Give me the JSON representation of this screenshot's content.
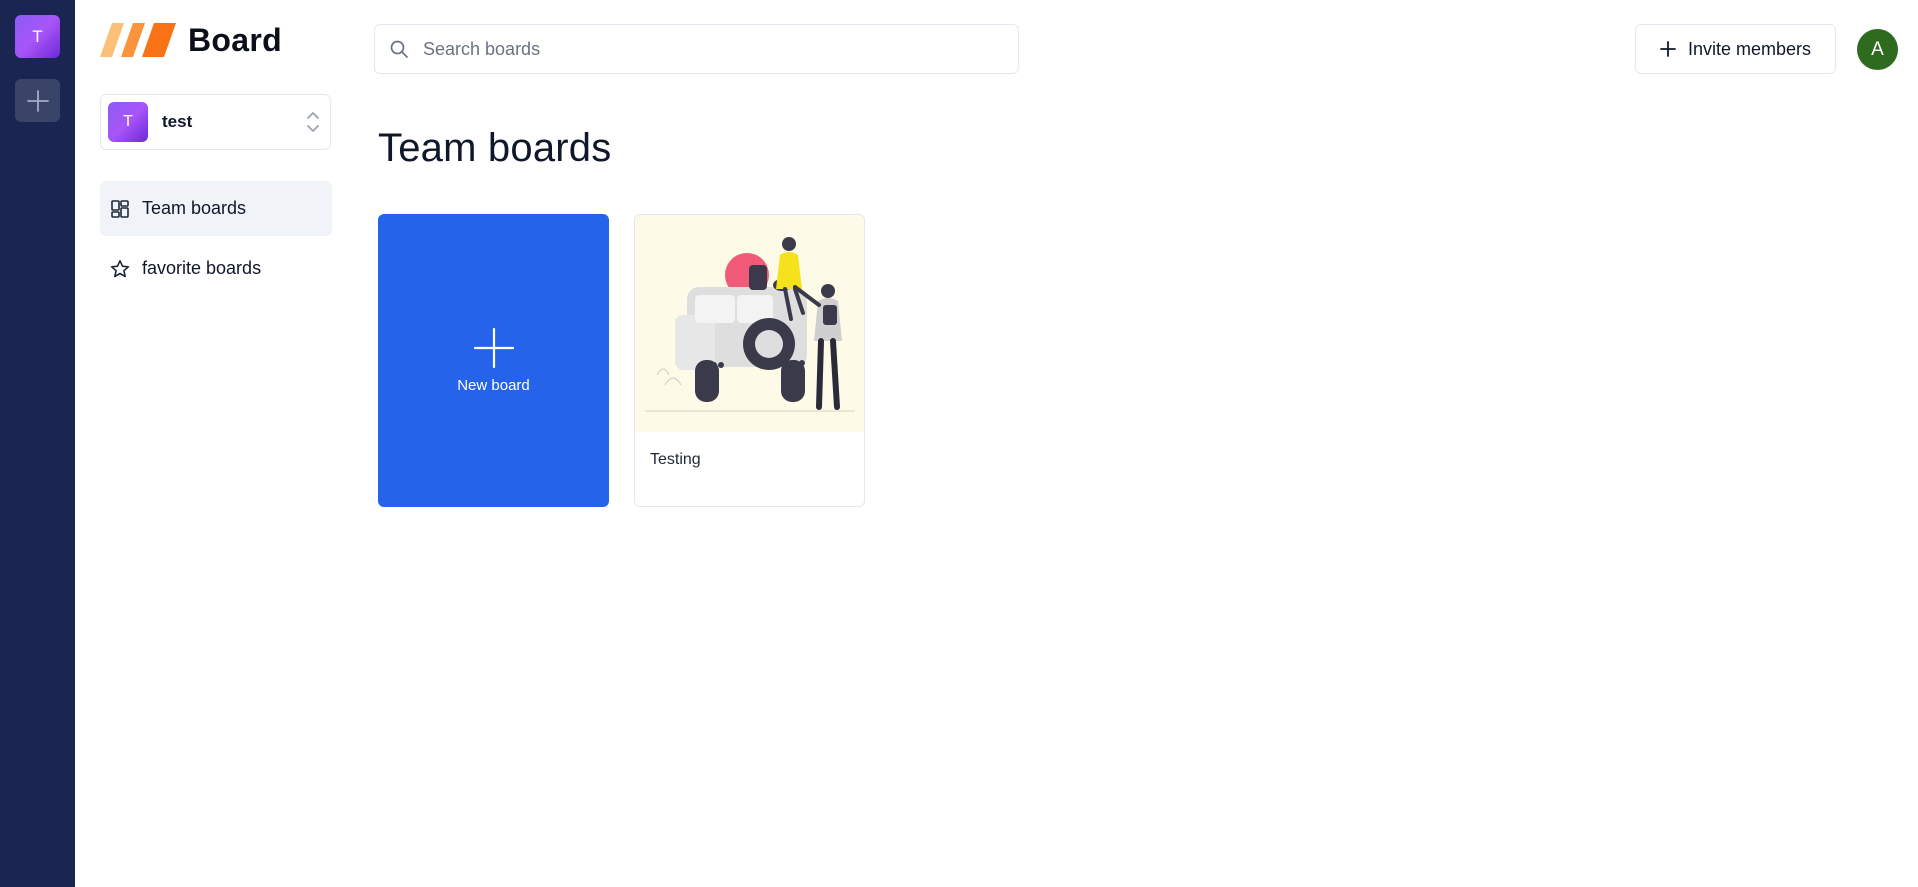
{
  "rail": {
    "current_org_initial": "T"
  },
  "sidebar": {
    "logo_text": "Board",
    "org": {
      "initial": "T",
      "name": "test"
    },
    "nav": [
      {
        "label": "Team boards",
        "icon": "layout-dashboard-icon",
        "active": true
      },
      {
        "label": "favorite boards",
        "icon": "star-icon",
        "active": false
      }
    ]
  },
  "header": {
    "search_placeholder": "Search boards",
    "search_value": "",
    "invite_label": "Invite members",
    "user_initial": "A"
  },
  "main": {
    "title": "Team boards",
    "new_board_label": "New board",
    "boards": [
      {
        "title": "Testing"
      }
    ]
  },
  "colors": {
    "rail_bg": "#1b2552",
    "accent_blue": "#2563eb",
    "org_purple": "#8b5cf6",
    "user_avatar": "#2f6b1f",
    "logo_orange": "#f97316"
  }
}
